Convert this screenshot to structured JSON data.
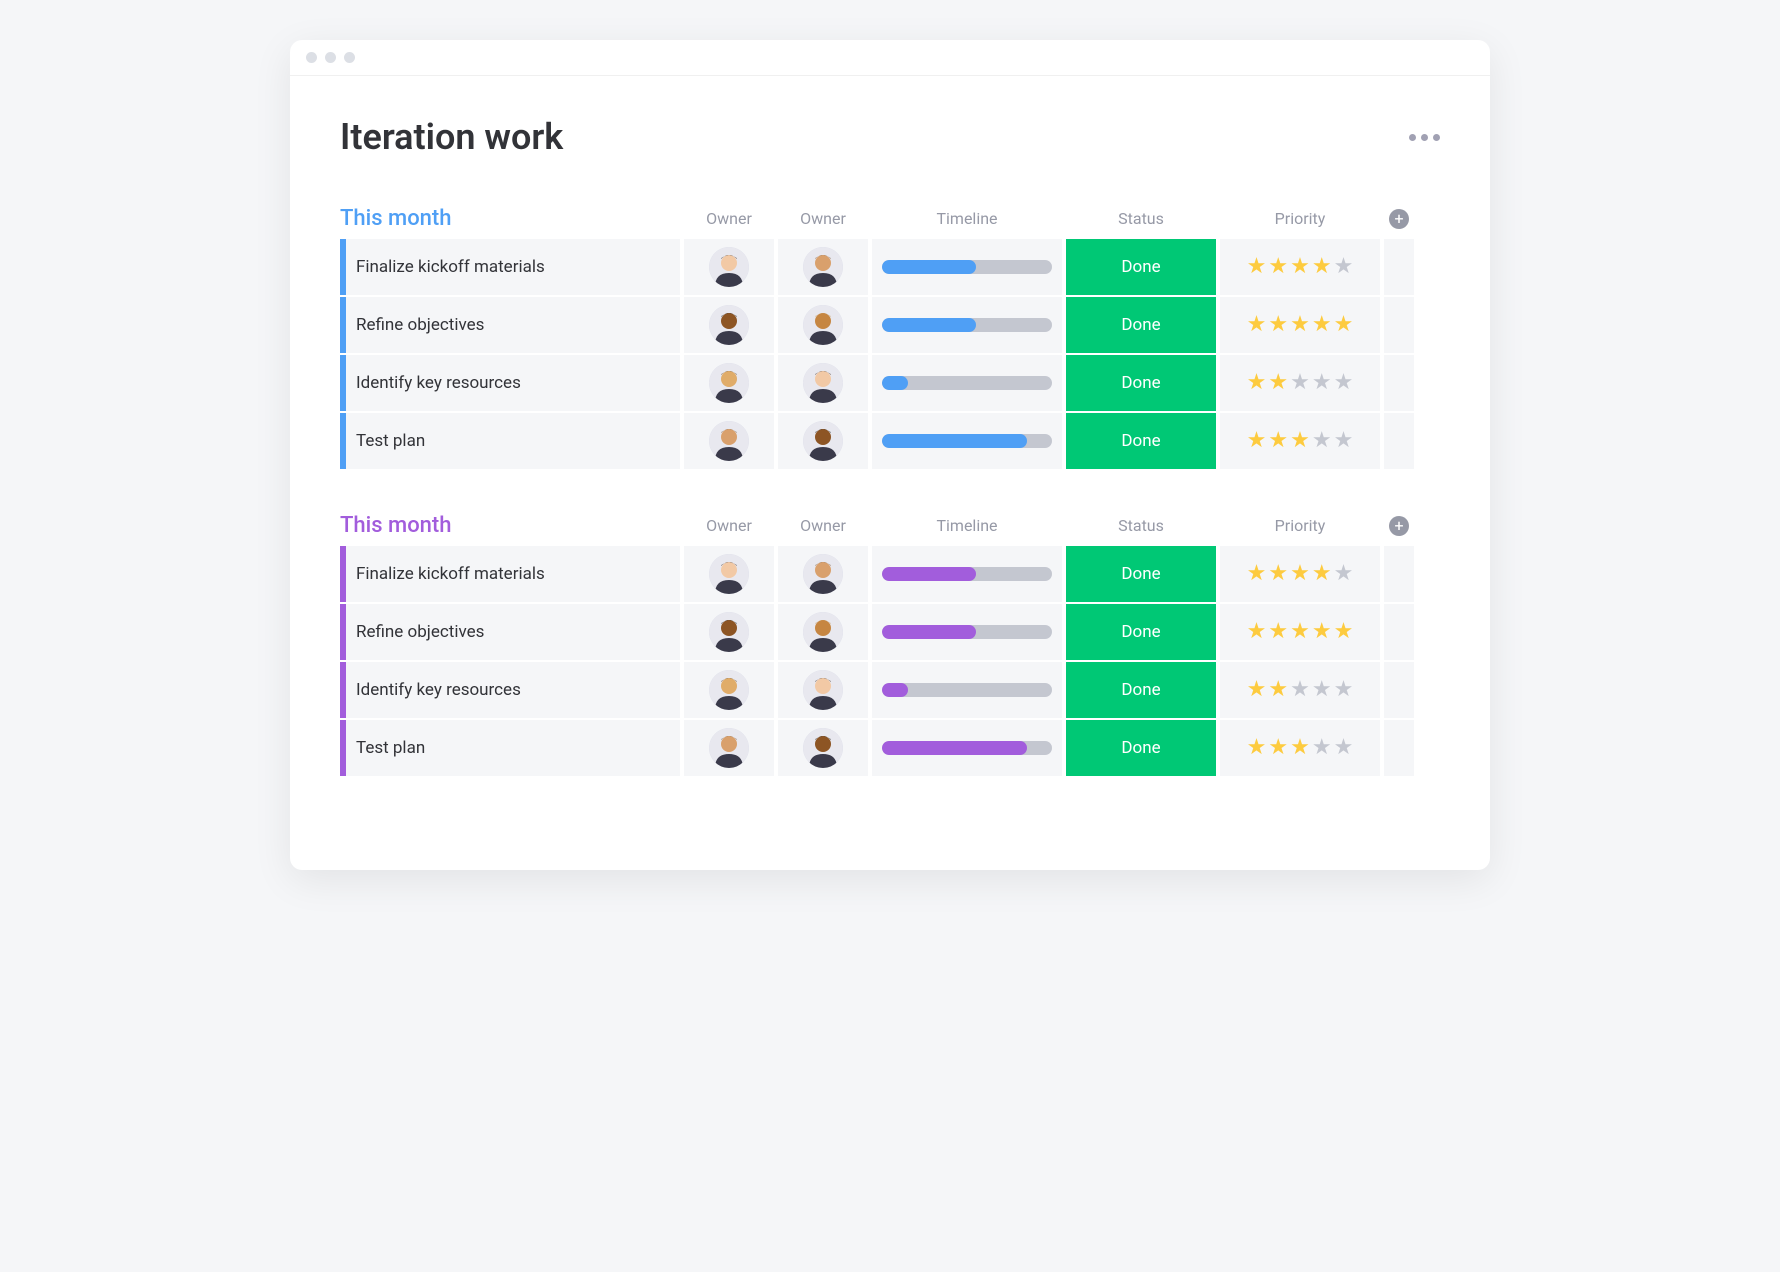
{
  "page_title": "Iteration work",
  "columns": {
    "owner1": "Owner",
    "owner2": "Owner",
    "timeline": "Timeline",
    "status": "Status",
    "priority": "Priority"
  },
  "groups": [
    {
      "title": "This month",
      "title_color": "#4f9ff5",
      "accent_class": "blue-accent",
      "bar_color": "#4f9ff5",
      "rows": [
        {
          "task": "Finalize kickoff materials",
          "progress": 55,
          "status": "Done",
          "status_color": "#00c875",
          "stars": 4
        },
        {
          "task": "Refine objectives",
          "progress": 55,
          "status": "Done",
          "status_color": "#00c875",
          "stars": 5
        },
        {
          "task": "Identify key resources",
          "progress": 15,
          "status": "Done",
          "status_color": "#00c875",
          "stars": 2
        },
        {
          "task": "Test plan",
          "progress": 85,
          "status": "Done",
          "status_color": "#00c875",
          "stars": 3
        }
      ]
    },
    {
      "title": "This month",
      "title_color": "#a25ddc",
      "accent_class": "purple-accent",
      "bar_color": "#a25ddc",
      "rows": [
        {
          "task": "Finalize kickoff materials",
          "progress": 55,
          "status": "Done",
          "status_color": "#00c875",
          "stars": 4
        },
        {
          "task": "Refine objectives",
          "progress": 55,
          "status": "Done",
          "status_color": "#00c875",
          "stars": 5
        },
        {
          "task": "Identify key resources",
          "progress": 15,
          "status": "Done",
          "status_color": "#00c875",
          "stars": 2
        },
        {
          "task": "Test plan",
          "progress": 85,
          "status": "Done",
          "status_color": "#00c875",
          "stars": 3
        }
      ]
    }
  ]
}
